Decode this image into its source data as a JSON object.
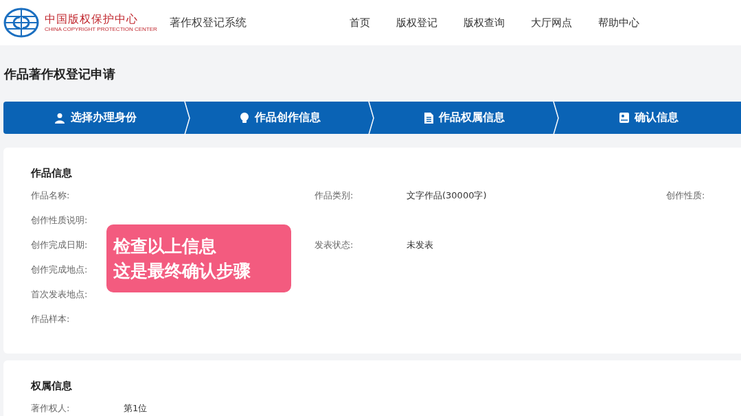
{
  "header": {
    "logo_cn": "中国版权保护中心",
    "logo_en": "CHINA COPYRIGHT PROTECTION CENTER",
    "system_name": "著作权登记系统",
    "nav": [
      "首页",
      "版权登记",
      "版权查询",
      "大厅网点",
      "帮助中心"
    ]
  },
  "page_title": "作品著作权登记申请",
  "steps": [
    {
      "label": "选择办理身份",
      "kind": "person"
    },
    {
      "label": "作品创作信息",
      "kind": "bulb"
    },
    {
      "label": "作品权属信息",
      "kind": "document"
    },
    {
      "label": "确认信息",
      "kind": "card"
    }
  ],
  "work_info": {
    "heading": "作品信息",
    "rows": [
      {
        "left": {
          "label": "作品名称:"
        },
        "middle": {
          "label": "作品类别:",
          "value": "文字作品(30000字)"
        },
        "right": {
          "label": "创作性质:"
        }
      },
      {
        "left": {
          "label": "创作性质说明:"
        }
      },
      {
        "left": {
          "label": "创作完成日期:"
        },
        "middle": {
          "label": "发表状态:",
          "value": "未发表"
        }
      },
      {
        "left": {
          "label": "创作完成地点:"
        }
      },
      {
        "left": {
          "label": "首次发表地点:"
        }
      },
      {
        "left": {
          "label": "作品样本:"
        }
      }
    ]
  },
  "ownership_info": {
    "heading": "权属信息",
    "rows": [
      {
        "label": "著作权人:",
        "value": "第1位"
      }
    ]
  },
  "overlay_caption": [
    "检查以上信息",
    "这是最终确认步骤"
  ]
}
